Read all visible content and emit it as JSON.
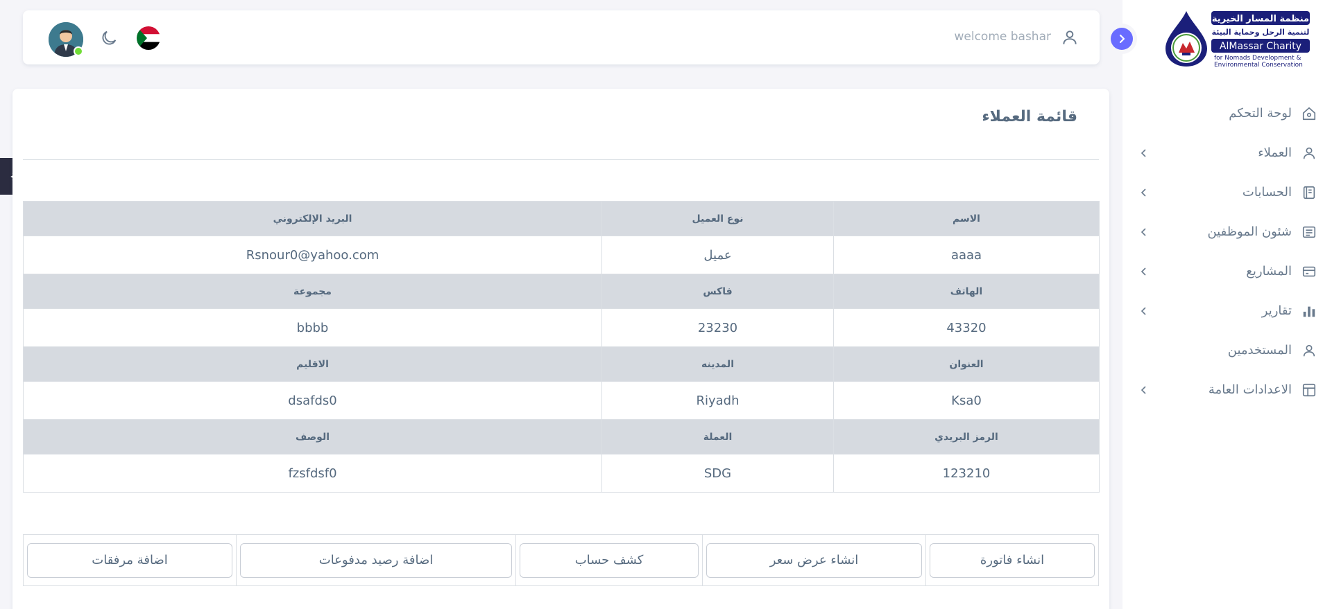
{
  "sidebar": {
    "logo": {
      "title_ar": "منظمة المسار الخيرية",
      "subtitle_ar": "لتنمية الرحل وحماية البيئة",
      "title_en": "AlMassar Charity",
      "subtitle_en_1": "for Nomads Development &",
      "subtitle_en_2": "Environmental Conservation"
    },
    "items": [
      {
        "label": "لوحة التحكم",
        "icon": "home-icon",
        "has_submenu": false
      },
      {
        "label": "العملاء",
        "icon": "user-icon",
        "has_submenu": true
      },
      {
        "label": "الحسابات",
        "icon": "book-icon",
        "has_submenu": true
      },
      {
        "label": "شئون الموظفين",
        "icon": "document-icon",
        "has_submenu": true
      },
      {
        "label": "المشاريع",
        "icon": "credit-card-icon",
        "has_submenu": true
      },
      {
        "label": "تقارير",
        "icon": "bar-chart-icon",
        "has_submenu": true
      },
      {
        "label": "المستخدمين",
        "icon": "user-icon",
        "has_submenu": false
      },
      {
        "label": "الاعدادات العامة",
        "icon": "layout-icon",
        "has_submenu": true
      }
    ]
  },
  "navbar": {
    "welcome": "welcome bashar",
    "user_icon": "user-icon",
    "flag": "sudan-flag-icon",
    "theme_icon": "moon-icon",
    "avatar": "avatar"
  },
  "card": {
    "title": "قائمة العملاء",
    "rows": [
      {
        "headers": [
          "الاسم",
          "نوع العميل",
          "البريد الإلكتروني"
        ],
        "values": [
          "aaaa",
          "عميل",
          "Rsnour0@yahoo.com"
        ]
      },
      {
        "headers": [
          "الهاتف",
          "فاكس",
          "مجموعة"
        ],
        "values": [
          "43320",
          "23230",
          "bbbb"
        ]
      },
      {
        "headers": [
          "العنوان",
          "المدينه",
          "الاقليم"
        ],
        "values": [
          "Ksa0",
          "Riyadh",
          "dsafds0"
        ]
      },
      {
        "headers": [
          "الرمز البريدي",
          "العملة",
          "الوصف"
        ],
        "values": [
          "123210",
          "SDG",
          "fzsfdsf0"
        ]
      }
    ],
    "actions": [
      "انشاء فاتورة",
      "انشاء عرض سعر",
      "كشف حساب",
      "اضافة رصيد مدفوعات",
      "اضافة مرفقات"
    ]
  },
  "colors": {
    "primary": "#696cff",
    "text": "#566a7f",
    "muted": "#a1acb8",
    "header_bg": "#d6dae0",
    "online": "#71dd37",
    "logo_blue": "#1b1f7a"
  }
}
